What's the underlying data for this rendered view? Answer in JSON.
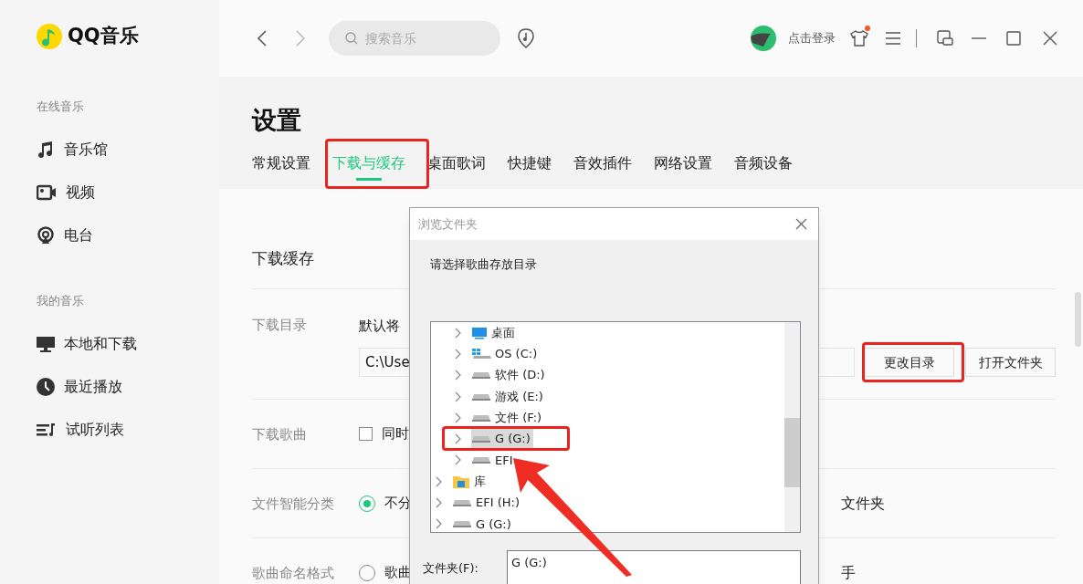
{
  "app": {
    "name": "QQ音乐"
  },
  "sidebar": [
    {
      "title": "在线音乐",
      "items": [
        {
          "label": "音乐馆",
          "kind": "note"
        },
        {
          "label": "视频",
          "kind": "video"
        },
        {
          "label": "电台",
          "kind": "radio"
        }
      ]
    },
    {
      "title": "我的音乐",
      "items": [
        {
          "label": "本地和下载",
          "kind": "monitor"
        },
        {
          "label": "最近播放",
          "kind": "clock"
        },
        {
          "label": "试听列表",
          "kind": "list"
        }
      ]
    }
  ],
  "topbar": {
    "back_disabled": false,
    "forward_disabled": true,
    "search": {
      "placeholder": "搜索音乐"
    },
    "login": "点击登录",
    "skin_badge": true
  },
  "page": {
    "title": "设置",
    "tabs": [
      {
        "label": "常规设置",
        "selected": false
      },
      {
        "label": "下载与缓存",
        "selected": true
      },
      {
        "label": "桌面歌词",
        "selected": false
      },
      {
        "label": "快捷键",
        "selected": false
      },
      {
        "label": "音效插件",
        "selected": false
      },
      {
        "label": "网络设置",
        "selected": false
      },
      {
        "label": "音频设备",
        "selected": false
      }
    ]
  },
  "section": {
    "title": "下载缓存",
    "rows": [
      {
        "kind": "directory",
        "label": "下载目录",
        "note": "默认将",
        "path": "C:\\Use",
        "buttons": [
          {
            "label": "更改目录"
          },
          {
            "label": "打开文件夹"
          }
        ]
      },
      {
        "kind": "checkbox",
        "label": "下载歌曲",
        "option": "同时",
        "checked": false
      },
      {
        "kind": "radio",
        "label": "文件智能分类",
        "option": "不分",
        "checked": true,
        "right_text": "文件夹"
      },
      {
        "kind": "radio",
        "label": "歌曲命名格式",
        "option": "歌曲",
        "checked": false,
        "right_text": "手"
      }
    ]
  },
  "dialog": {
    "title": "浏览文件夹",
    "prompt": "请选择歌曲存放目录",
    "tree": [
      {
        "children": [
          {
            "label": "桌面",
            "kind": "desktop",
            "selected": false
          },
          {
            "label": "OS (C:)",
            "kind": "windows-drive",
            "selected": false
          },
          {
            "label": "软件 (D:)",
            "kind": "drive",
            "selected": false
          },
          {
            "label": "游戏 (E:)",
            "kind": "drive",
            "selected": false
          },
          {
            "label": "文件 (F:)",
            "kind": "drive",
            "selected": false
          },
          {
            "label": "G (G:)",
            "kind": "drive",
            "selected": true
          },
          {
            "label": "EFI",
            "kind": "drive",
            "selected": false
          }
        ]
      },
      {
        "label": "库",
        "kind": "library",
        "selected": false
      },
      {
        "label": "EFI (H:)",
        "kind": "drive",
        "selected": false
      },
      {
        "label": "G (G:)",
        "kind": "drive",
        "selected": false
      }
    ],
    "folder_label": "文件夹(F):",
    "folder_value": "G (G:)"
  }
}
